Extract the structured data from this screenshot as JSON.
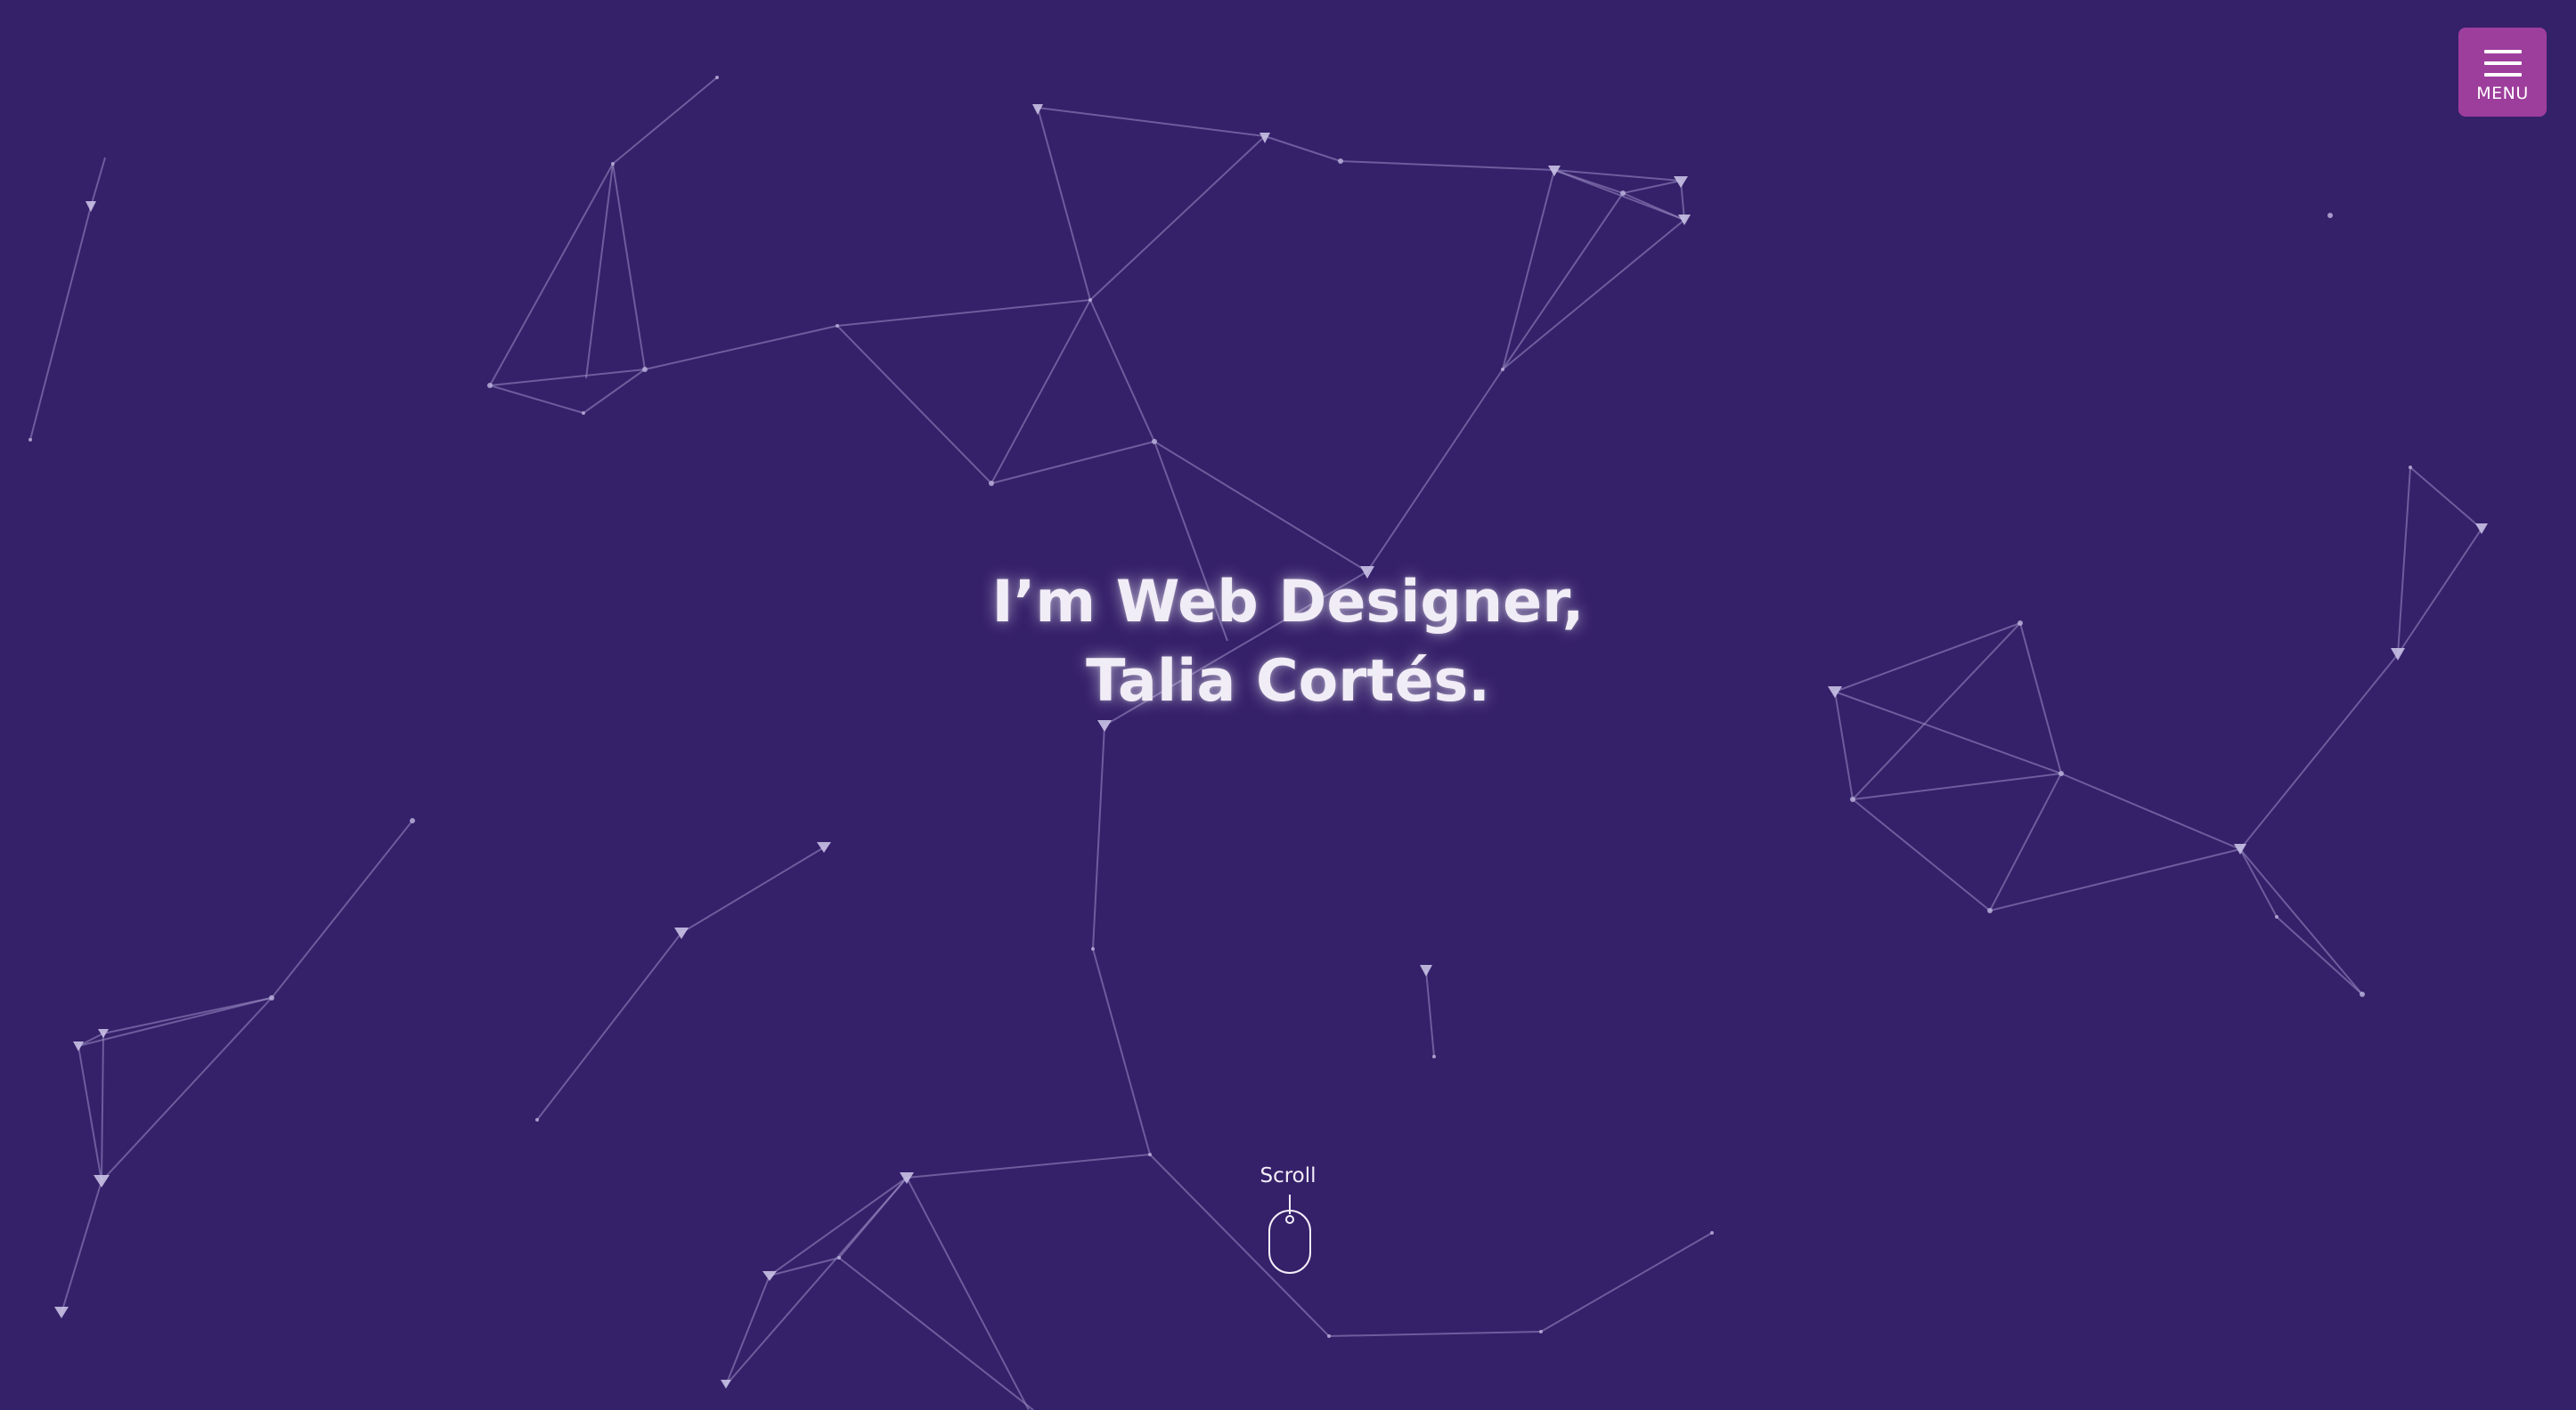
{
  "theme": {
    "background": "#35206a",
    "accent": "#9d3e9c",
    "text": "#f1edf7",
    "network_line": "#8c82b4"
  },
  "hero": {
    "line1": "I’m Web Designer,",
    "line2": "Talia Cortés."
  },
  "menu": {
    "label": "MENU",
    "icon": "hamburger-icon"
  },
  "scroll": {
    "label": "Scroll",
    "icon": "mouse-scroll-icon"
  },
  "background": {
    "icon": "particle-network"
  }
}
